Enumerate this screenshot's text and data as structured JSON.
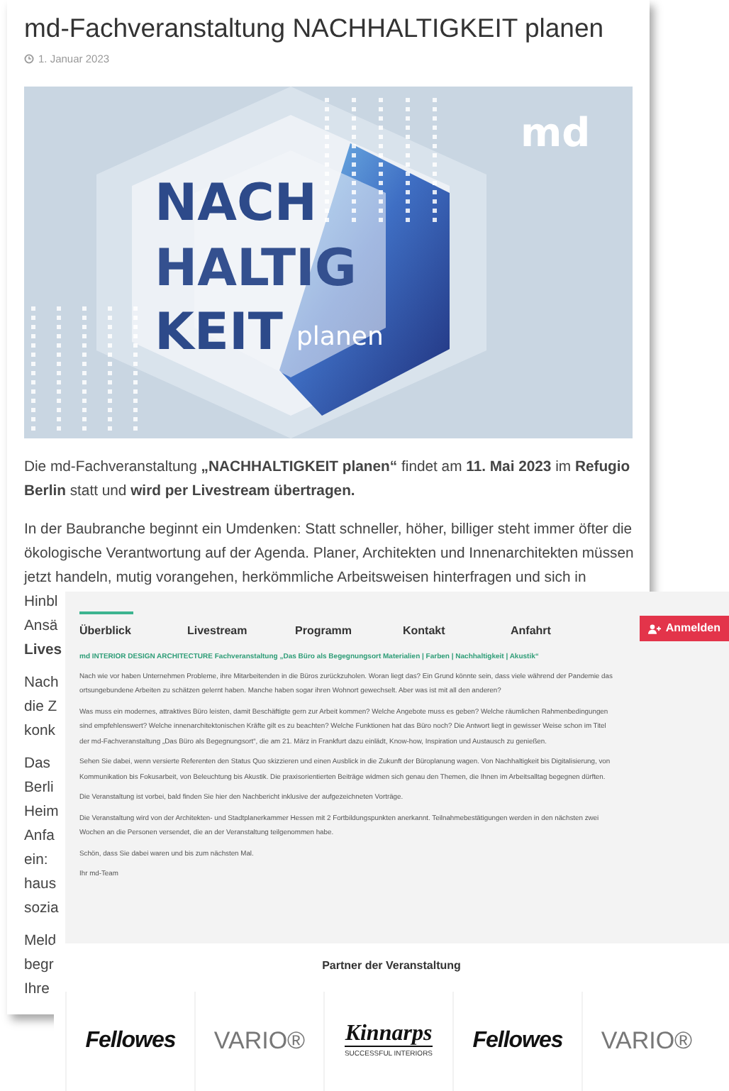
{
  "article": {
    "title": "md-Fachveranstaltung NACHHALTIGKEIT planen",
    "date": "1. Januar 2023",
    "key_visual": {
      "headline": [
        "NACH",
        "HALTIG",
        "KEIT"
      ],
      "subline": "planen",
      "logo": "md"
    },
    "intro": "Die md-Fachveranstaltung **„NACHHALTIGKEIT planen“** findet am **11. Mai 2023** im **Refugio Berlin** statt und **wird per Livestream übertragen.**",
    "paragraphs": [
      [
        {
          "text": "In der Baubranche beginnt ein Umdenken: Statt schneller, höher, billiger steht immer öfter die",
          "bold": false
        },
        {
          "text": "ökologische Verantwortung auf der Agenda. Planer, Architekten und Innenarchitekten müssen",
          "bold": false
        },
        {
          "text": "jetzt handeln, mutig vorangehen, herkömmliche Arbeitsweisen hinterfragen und sich in",
          "bold": false
        },
        {
          "text": "Hinbl",
          "bold": false
        },
        {
          "text": "Ansä",
          "bold": false
        },
        {
          "text": "Lives",
          "bold": true
        }
      ],
      [
        {
          "text": "Nach",
          "bold": false
        },
        {
          "text": "die Z",
          "bold": false
        },
        {
          "text": "konk",
          "bold": false
        }
      ],
      [
        {
          "text": "Das",
          "bold": false
        },
        {
          "text": "Berli",
          "bold": false
        },
        {
          "text": "Heim",
          "bold": false
        },
        {
          "text": "Anfa",
          "bold": false
        },
        {
          "text": "ein:",
          "bold": false
        },
        {
          "text": "haus",
          "bold": false
        },
        {
          "text": "sozia",
          "bold": false
        }
      ],
      [
        {
          "text": "Meld",
          "bold": false
        },
        {
          "text": "begr",
          "bold": false
        },
        {
          "text": "Ihre",
          "bold": false
        }
      ]
    ]
  },
  "overlay": {
    "nav": [
      {
        "label": "Überblick",
        "selected": true
      },
      {
        "label": "Livestream",
        "selected": false
      },
      {
        "label": "Programm",
        "selected": false
      },
      {
        "label": "Kontakt",
        "selected": false
      },
      {
        "label": "Anfahrt",
        "selected": false
      }
    ],
    "register_button": "Anmelden",
    "heading": "md INTERIOR DESIGN ARCHITECTURE Fachveranstaltung „Das Büro als Begegnungsort Materialien | Farben | Nachhaltigkeit | Akustik“",
    "paragraphs": [
      [
        "Nach wie vor haben Unternehmen Probleme, ihre Mitarbeitenden in die Büros zurückzuholen. Woran liegt das? Ein Grund könnte sein, dass viele während der Pandemie das",
        "ortsungebundene Arbeiten zu schätzen gelernt haben. Manche haben sogar ihren Wohnort gewechselt. Aber was ist mit all den anderen?"
      ],
      [
        "Was muss ein modernes, attraktives Büro leisten, damit Beschäftigte gern zur Arbeit kommen? Welche Angebote muss es geben? Welche räumlichen Rahmenbedingungen",
        "sind empfehlenswert? Welche innenarchitektonischen Kräfte gilt es zu beachten? Welche Funktionen hat das Büro noch? Die Antwort liegt in gewisser Weise schon im Titel",
        "der md-Fachveranstaltung „Das Büro als Begegnungsort“, die am 21. März in Frankfurt dazu einlädt, Know-how, Inspiration und Austausch zu genießen."
      ],
      [
        "Sehen Sie dabei, wenn versierte Referenten den Status Quo skizzieren und einen Ausblick in die Zukunft der Büroplanung wagen. Von Nachhaltigkeit bis Digitalisierung, von",
        "Kommunikation bis Fokusarbeit, von Beleuchtung bis Akustik. Die praxisorientierten Beiträge widmen sich genau den Themen, die Ihnen im Arbeitsalltag begegnen dürften."
      ],
      [
        "Die Veranstaltung ist vorbei, bald finden Sie hier den Nachbericht inklusive der aufgezeichneten Vorträge."
      ],
      [
        "Die Veranstaltung wird von der Architekten- und Stadtplanerkammer Hessen mit 2 Fortbildungspunkten anerkannt. Teilnahmebestätigungen werden in den nächsten zwei",
        "Wochen an die Personen versendet, die an der Veranstaltung teilgenommen habe."
      ],
      [
        "Schön, dass Sie dabei waren und bis zum nächsten Mal."
      ],
      [
        "Ihr md-Team"
      ]
    ],
    "partners": {
      "title": "Partner der Veranstaltung",
      "logos": [
        {
          "kind": "fellowes",
          "text": "Fellowes"
        },
        {
          "kind": "vario",
          "text": "VARIO®"
        },
        {
          "kind": "kinnarps",
          "text": "Kinnarps",
          "tagline": "SUCCESSFUL INTERIORS"
        },
        {
          "kind": "fellowes",
          "text": "Fellowes"
        },
        {
          "kind": "vario",
          "text": "VARIO®"
        }
      ]
    }
  }
}
